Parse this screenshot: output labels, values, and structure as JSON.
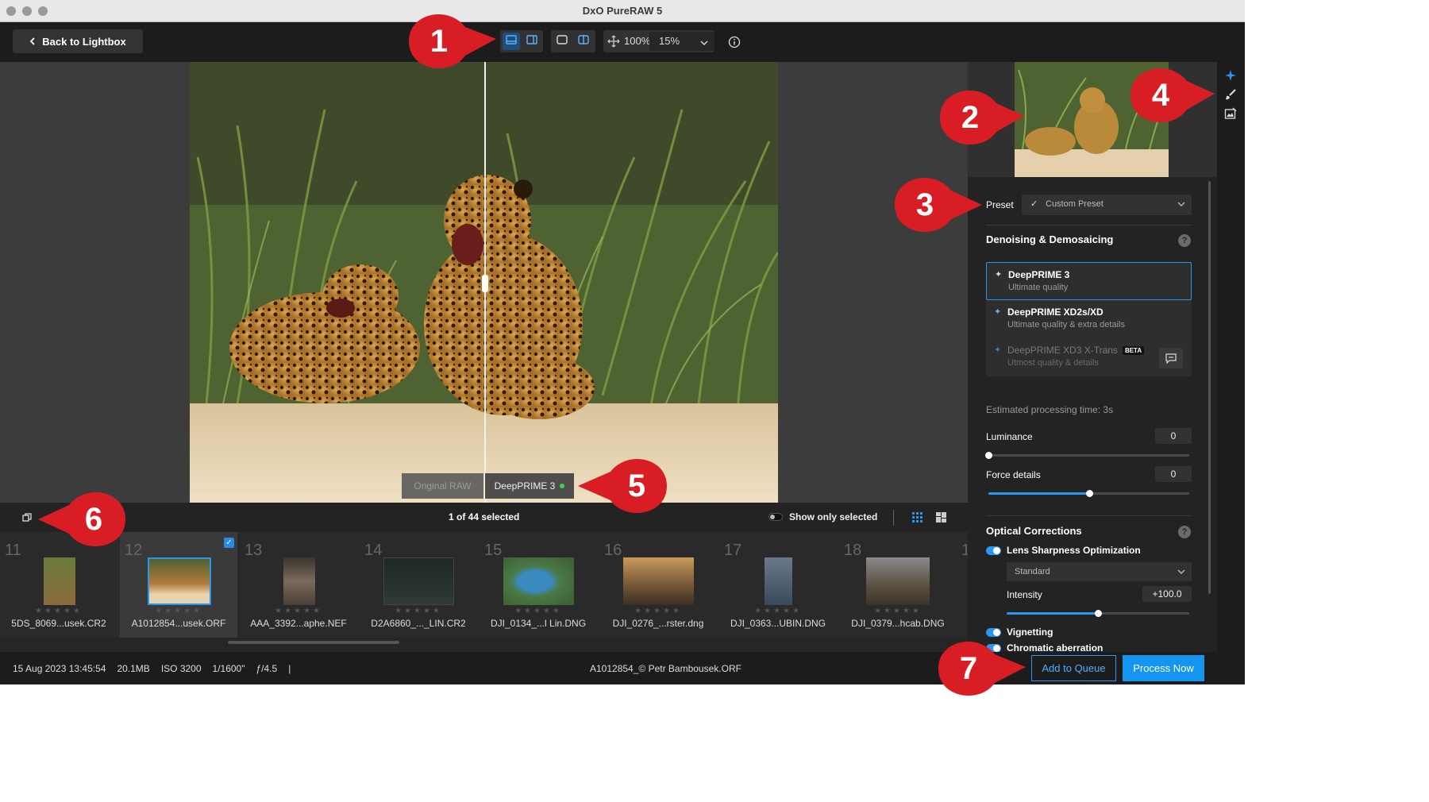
{
  "window": {
    "title": "DxO PureRAW 5"
  },
  "toolbar": {
    "back_label": "Back to Lightbox",
    "zoom_fit": "100%",
    "zoom_value": "15%"
  },
  "viewer": {
    "label_original": "Original RAW",
    "label_processed": "DeepPRIME 3"
  },
  "filmstrip_bar": {
    "count": "1 of 44 selected",
    "show_only_selected": "Show only selected"
  },
  "filmstrip": [
    {
      "number": "11",
      "filename": "5DS_8069...usek.CR2",
      "selected": false
    },
    {
      "number": "12",
      "filename": "A1012854...usek.ORF",
      "selected": true
    },
    {
      "number": "13",
      "filename": "AAA_3392...aphe.NEF",
      "selected": false
    },
    {
      "number": "14",
      "filename": "D2A6860_..._LIN.CR2",
      "selected": false
    },
    {
      "number": "15",
      "filename": "DJI_0134_...l Lin.DNG",
      "selected": false
    },
    {
      "number": "16",
      "filename": "DJI_0276_...rster.dng",
      "selected": false
    },
    {
      "number": "17",
      "filename": "DJI_0363...UBIN.DNG",
      "selected": false
    },
    {
      "number": "18",
      "filename": "DJI_0379...hcab.DNG",
      "selected": false
    },
    {
      "number": "1",
      "filename": "",
      "selected": false
    }
  ],
  "status": {
    "date": "15 Aug 2023 13:45:54",
    "size": "20.1MB",
    "iso": "ISO 3200",
    "shutter": "1/1600\"",
    "aperture": "ƒ/4.5",
    "divider": "|",
    "filename": "A1012854_© Petr Bambousek.ORF",
    "add_to_queue": "Add to Queue",
    "process_now": "Process Now"
  },
  "settings": {
    "preset_label": "Preset",
    "preset_value": "Custom Preset",
    "denoise_header": "Denoising & Demosaicing",
    "options": [
      {
        "title": "DeepPRIME 3",
        "subtitle": "Ultimate quality",
        "active": true
      },
      {
        "title": "DeepPRIME XD2s/XD",
        "subtitle": "Ultimate quality & extra details",
        "active": false
      },
      {
        "title": "DeepPRIME XD3 X-Trans",
        "badge": "BETA",
        "subtitle": "Utmost quality & details",
        "active": false
      }
    ],
    "est_time": "Estimated processing time:  3s",
    "luminance_label": "Luminance",
    "luminance_value": "0",
    "luminance_level": 0,
    "force_label": "Force details",
    "force_value": "0",
    "force_level": 0.5,
    "optical_header": "Optical Corrections",
    "lens_label": "Lens Sharpness Optimization",
    "lens_mode": "Standard",
    "intensity_label": "Intensity",
    "intensity_value": "+100.0",
    "intensity_level": 0.5,
    "vignetting_label": "Vignetting",
    "chromatic_label": "Chromatic aberration",
    "help": "?"
  },
  "callouts": [
    "1",
    "2",
    "3",
    "4",
    "5",
    "6",
    "7"
  ],
  "colors": {
    "accent": "#2a96f0",
    "callout": "#d81e24",
    "status_dot": "#3cd24b"
  },
  "icons": [
    "chevron-left-icon",
    "split-horizontal-icon",
    "side-by-side-icon",
    "single-view-icon",
    "compare-view-icon",
    "move-icon",
    "chevron-down-icon",
    "info-icon",
    "sparkle-icon",
    "brush-icon",
    "image-edit-icon",
    "feedback-icon",
    "duplicate-icon",
    "grid-view-icon",
    "mosaic-view-icon",
    "help-icon"
  ]
}
